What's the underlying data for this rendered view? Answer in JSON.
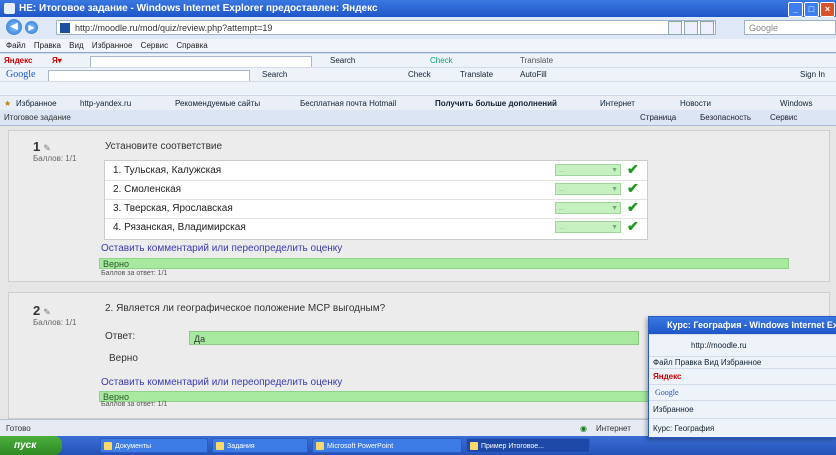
{
  "window": {
    "title": "HE: Итоговое задание - Windows Internet Explorer предоставлен: Яндекс",
    "url": "http://moodle.ru/mod/quiz/review.php?attempt=19",
    "search_placeholder": "Google"
  },
  "menubar": [
    "Файл",
    "Правка",
    "Вид",
    "Избранное",
    "Сервис",
    "Справка"
  ],
  "toolbar1": {
    "yandex": "Яндекс",
    "search": "Search",
    "items": [
      "Search",
      "Check",
      "Translate",
      "AutoFill"
    ]
  },
  "toolbar2": {
    "google": "Google",
    "search": "Search",
    "sign_in": "Sign In"
  },
  "favbar": {
    "favorites": "Избранное",
    "items": [
      "http-yandex.ru",
      "Рекомендуемые сайты",
      "Бесплатная почта Hotmail",
      "Получить больше дополнений",
      "Интернет",
      "Новости",
      "Windows"
    ]
  },
  "tabrow": {
    "tab": "Итоговое задание",
    "tools": [
      "Страница",
      "Безопасность",
      "Сервис"
    ]
  },
  "q1": {
    "num": "1",
    "score_label": "Баллов: 1/1",
    "text": "Установите соответствие",
    "rows": [
      {
        "label": "1. Тульская, Калужская",
        "answer": "..."
      },
      {
        "label": "2. Смоленская",
        "answer": "..."
      },
      {
        "label": "3. Тверская, Ярославская",
        "answer": "..."
      },
      {
        "label": "4. Рязанская, Владимирская",
        "answer": "..."
      }
    ],
    "comment_link": "Оставить комментарий или переопределить оценку",
    "feedback": "Верно",
    "score": "Баллов за ответ: 1/1"
  },
  "q2": {
    "num": "2",
    "score_label": "Баллов: 1/1",
    "text": "2. Является ли географическое положение МСР выгодным?",
    "answer_label": "Ответ:",
    "answer": "Да",
    "correct": "Верно",
    "comment_link": "Оставить комментарий или переопределить оценку",
    "feedback": "Верно",
    "score": "Баллов за ответ: 1/1"
  },
  "statusbar": {
    "left": "Готово",
    "zone": "Интернет"
  },
  "taskbar": {
    "start": "пуск",
    "tasks": [
      "Документы",
      "Задания",
      "Microsoft PowerPoint",
      "Пример Итоговое..."
    ]
  },
  "window2": {
    "title": "Курс: География - Windows Internet Explorer",
    "url": "http://moodle.ru",
    "tab": "Курс: География",
    "menu": "Файл  Правка  Вид  Избранное"
  }
}
